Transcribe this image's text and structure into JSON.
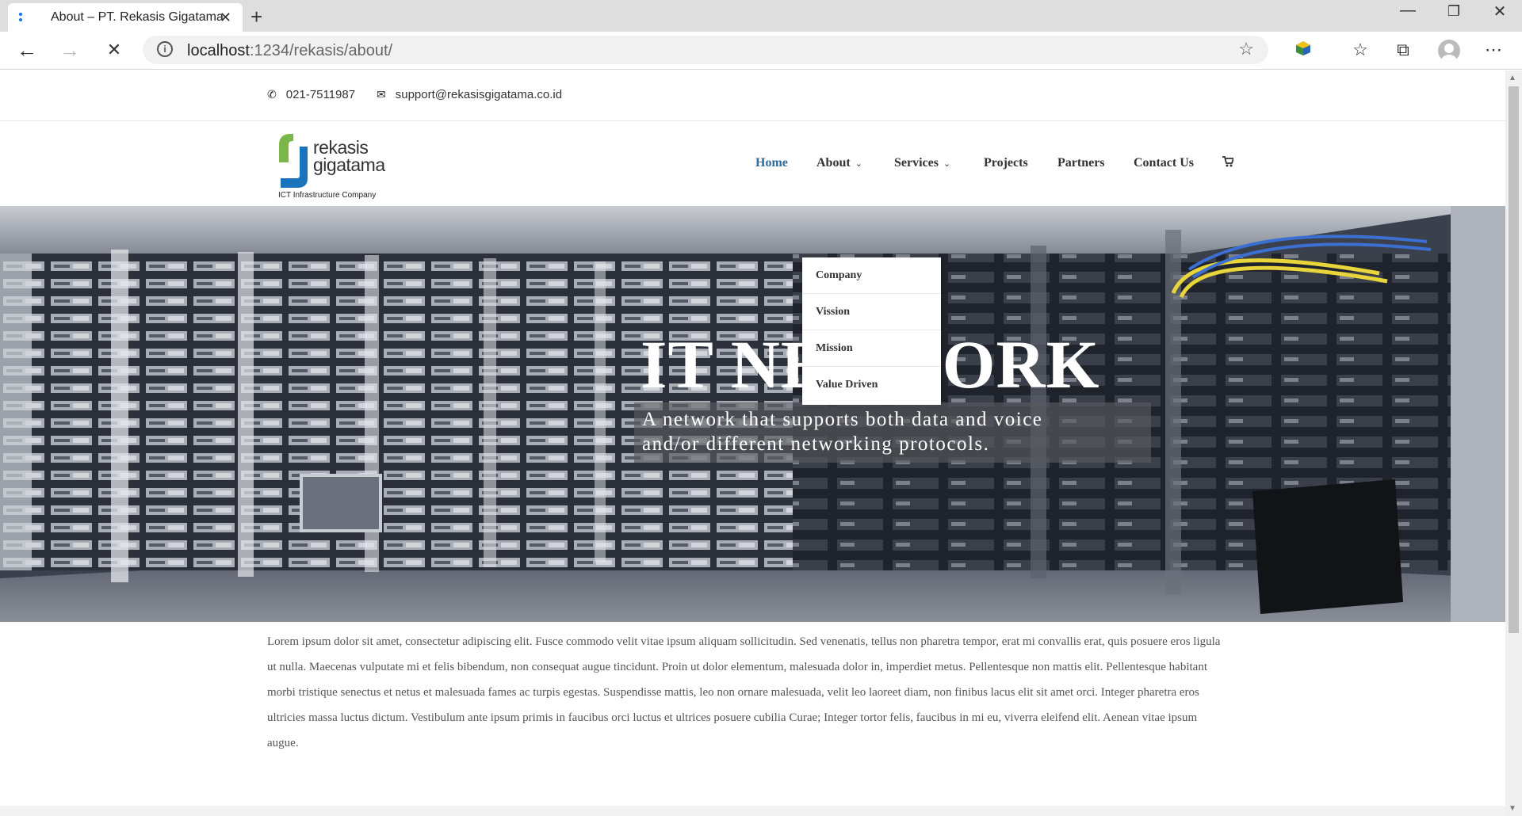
{
  "browser": {
    "tab_title": "About – PT. Rekasis Gigatama",
    "address_host": "localhost",
    "address_path": ":1234/rekasis/about/",
    "icons": [
      "favicon-icon",
      "close-tab-icon",
      "new-tab-icon",
      "back-icon",
      "forward-icon",
      "stop-icon",
      "info-icon",
      "favorite-star-icon",
      "extension-icon",
      "favorites-icon",
      "collections-icon",
      "profile-icon",
      "more-icon"
    ]
  },
  "topbar": {
    "phone": "021-7511987",
    "email": "support@rekasisgigatama.co.id"
  },
  "logo": {
    "name_line1": "rekasis",
    "name_line2": "gigatama",
    "tagline": "ICT Infrastructure Company",
    "colors": {
      "green": "#7ab648",
      "blue": "#1b74bb"
    }
  },
  "nav": {
    "home": "Home",
    "about": "About",
    "services": "Services",
    "projects": "Projects",
    "partners": "Partners",
    "contact": "Contact Us",
    "active_color": "#2d6b9b"
  },
  "about_dropdown": [
    "Company",
    "Vission",
    "Mission",
    "Value Driven"
  ],
  "hero": {
    "title": "IT NETWORK",
    "subtitle": "A network that supports both data and voice\nand/or different networking protocols."
  },
  "content": {
    "paragraph": "Lorem ipsum dolor sit amet, consectetur adipiscing elit. Fusce commodo velit vitae ipsum aliquam sollicitudin. Sed venenatis, tellus non pharetra tempor, erat mi convallis erat, quis posuere eros ligula ut nulla. Maecenas vulputate mi et felis bibendum, non consequat augue tincidunt. Proin ut dolor elementum, malesuada dolor in, imperdiet metus. Pellentesque non mattis elit. Pellentesque habitant morbi tristique senectus et netus et malesuada fames ac turpis egestas. Suspendisse mattis, leo non ornare malesuada, velit leo laoreet diam, non finibus lacus elit sit amet orci. Integer pharetra eros ultricies massa luctus dictum. Vestibulum ante ipsum primis in faucibus orci luctus et ultrices posuere cubilia Curae; Integer tortor felis, faucibus in mi eu, viverra eleifend elit. Aenean vitae ipsum augue."
  }
}
